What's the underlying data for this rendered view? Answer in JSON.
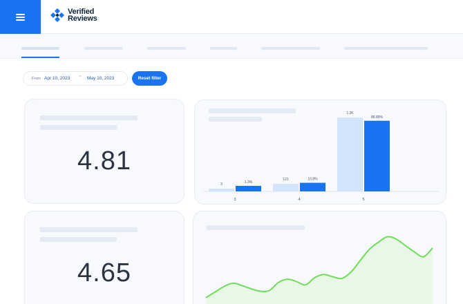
{
  "brand": {
    "name_line1": "Verified",
    "name_line2": "Reviews",
    "logo_icon": "verified-reviews-logo-icon",
    "accent_color": "#1a73f0"
  },
  "header": {
    "menu_icon": "hamburger-menu-icon"
  },
  "filter": {
    "from_label": "From",
    "start_date": "Apr 10, 2023",
    "separator": "~",
    "end_date": "May 10, 2023",
    "reset_label": "Reset filter"
  },
  "rating_cards": [
    {
      "value": "4.81"
    },
    {
      "value": "4.65"
    }
  ],
  "chart_data": [
    {
      "type": "bar",
      "categories": [
        "3",
        "4",
        "5"
      ],
      "series": [
        {
          "values": [
            3,
            121,
            1200
          ],
          "labels": [
            "3",
            "121",
            "1.2K"
          ],
          "color": "#d3e4fb"
        },
        {
          "values": [
            1.3,
            10.8,
            88.89
          ],
          "labels": [
            "1.3%",
            "10.8%",
            "88.89%"
          ],
          "color": "#1a73f0"
        }
      ]
    },
    {
      "type": "area",
      "values": [
        20,
        27,
        34,
        38,
        35,
        31,
        28,
        29,
        39,
        43,
        40,
        36,
        45,
        49,
        46,
        44,
        52,
        66,
        80,
        89,
        96,
        93,
        85,
        77,
        71,
        82
      ],
      "color": "#6fdc5a",
      "fill": "#e9f8e6"
    }
  ]
}
